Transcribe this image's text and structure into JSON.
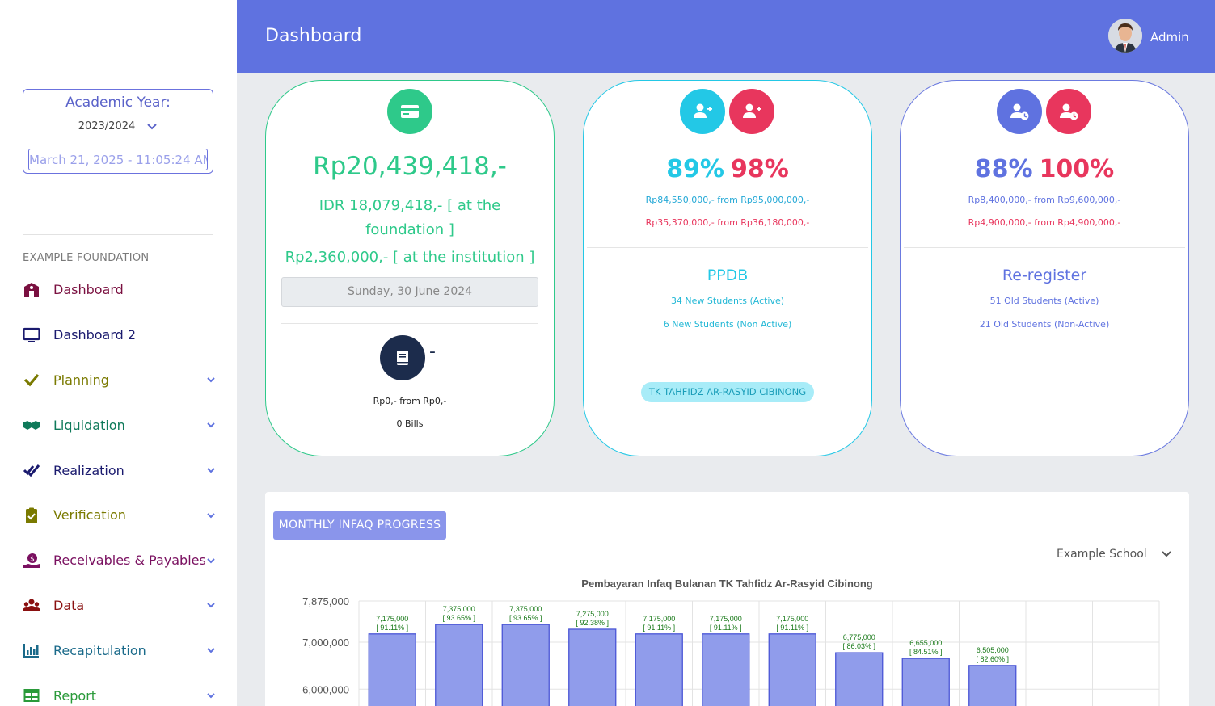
{
  "header": {
    "title": "Dashboard",
    "user": "Admin"
  },
  "sidebar": {
    "academic_year_label": "Academic Year:",
    "academic_year": "2023/2024",
    "datetime": "March 21, 2025 - 11:05:24 AM",
    "section": "EXAMPLE FOUNDATION",
    "items": [
      {
        "label": "Dashboard",
        "icon": "school-icon",
        "color": "#7a1040",
        "chevron": false
      },
      {
        "label": "Dashboard 2",
        "icon": "monitor-icon",
        "color": "#1a1a6e",
        "chevron": false
      },
      {
        "label": "Planning",
        "icon": "check-icon",
        "color": "#7a7a00",
        "chevron": true
      },
      {
        "label": "Liquidation",
        "icon": "handshake-icon",
        "color": "#0f7a5a",
        "chevron": true
      },
      {
        "label": "Realization",
        "icon": "double-check-icon",
        "color": "#1a1a6e",
        "chevron": true
      },
      {
        "label": "Verification",
        "icon": "clipboard-check-icon",
        "color": "#7a7a00",
        "chevron": true
      },
      {
        "label": "Receivables & Payables",
        "icon": "money-hand-icon",
        "color": "#7a1060",
        "chevron": true
      },
      {
        "label": "Data",
        "icon": "users-icon",
        "color": "#8a1010",
        "chevron": true
      },
      {
        "label": "Recapitulation",
        "icon": "bar-chart-icon",
        "color": "#1a6a8a",
        "chevron": true
      },
      {
        "label": "Report",
        "icon": "table-icon",
        "color": "#2a9a3a",
        "chevron": true
      }
    ]
  },
  "card1": {
    "amount": "Rp20,439,418,-",
    "foundation": "IDR 18,079,418,-  [ at the foundation ]",
    "institution": "Rp2,360,000,-  [ at the institution ]",
    "date": "Sunday, 30 June 2024",
    "dash": "-",
    "bills_amount": "Rp0,- from Rp0,-",
    "bills_count": "0 Bills"
  },
  "card2": {
    "pct1": "89%",
    "pct2": "98%",
    "line1": "Rp84,550,000,- from Rp95,000,000,-",
    "line2": "Rp35,370,000,- from Rp36,180,000,-",
    "title": "PPDB",
    "active": "34 New Students (Active)",
    "inactive": "6 New Students (Non Active)",
    "badge": "TK TAHFIDZ AR-RASYID CIBINONG"
  },
  "card3": {
    "pct1": "88%",
    "pct2": "100%",
    "line1": "Rp8,400,000,- from Rp9,600,000,-",
    "line2": "Rp4,900,000,- from Rp4,900,000,-",
    "title": "Re-register",
    "active": "51 Old Students (Active)",
    "inactive": "21 Old Students (Non-Active)"
  },
  "panel": {
    "button": "MONTHLY INFAQ PROGRESS",
    "school": "Example School"
  },
  "colors": {
    "green": "#2ec98a",
    "cyan": "#23c8e6",
    "red": "#e8365d",
    "indigo": "#5f72e0",
    "navy": "#1c2c4c"
  },
  "chart_data": {
    "type": "bar",
    "title": "Pembayaran Infaq Bulanan TK Tahfidz Ar-Rasyid Cibinong",
    "y_ticks": [
      "7,875,000",
      "7,000,000",
      "6,000,000"
    ],
    "ylim_visible": [
      5500000,
      7875000
    ],
    "values": [
      7175000,
      7375000,
      7375000,
      7275000,
      7175000,
      7175000,
      7175000,
      6775000,
      6655000,
      6505000
    ],
    "value_labels": [
      "7,175,000",
      "7,375,000",
      "7,375,000",
      "7,275,000",
      "7,175,000",
      "7,175,000",
      "7,175,000",
      "6,775,000",
      "6,655,000",
      "6,505,000"
    ],
    "percent_labels": [
      "[ 91.11% ]",
      "[ 93.65% ]",
      "[ 93.65% ]",
      "[ 92.38% ]",
      "[ 91.11% ]",
      "[ 91.11% ]",
      "[ 91.11% ]",
      "[ 86.03% ]",
      "[ 84.51% ]",
      "[ 82.60% ]"
    ],
    "bar_color": "#909ceb",
    "bar_border": "#4a56d6",
    "label_color": "#1a7a1a"
  }
}
